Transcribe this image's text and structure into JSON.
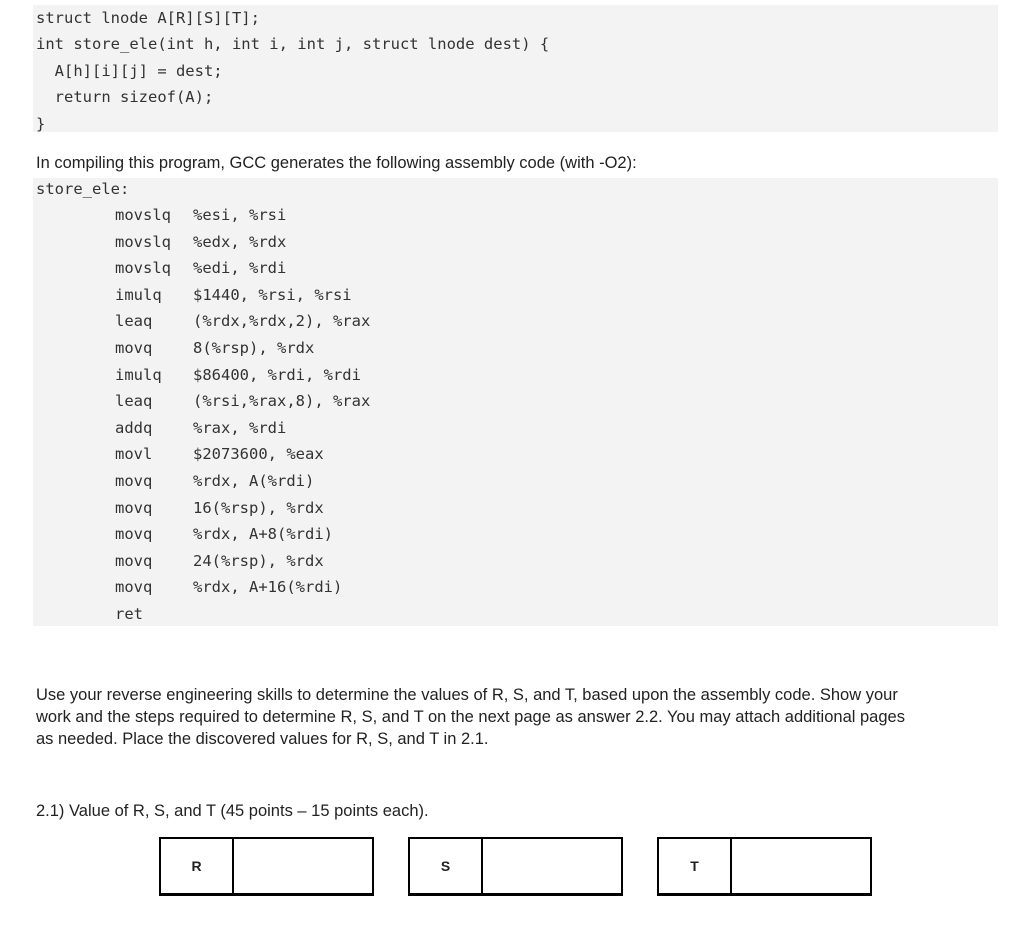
{
  "c_code": [
    "struct lnode A[R][S][T];",
    "int store_ele(int h, int i, int j, struct lnode dest) {",
    "  A[h][i][j] = dest;",
    "  return sizeof(A);",
    "}"
  ],
  "intro": "In compiling this program, GCC generates the following assembly code (with -O2):",
  "asm_label": "store_ele:",
  "asm": [
    {
      "op": "movslq",
      "args": "%esi, %rsi"
    },
    {
      "op": "movslq",
      "args": "%edx, %rdx"
    },
    {
      "op": "movslq",
      "args": "%edi, %rdi"
    },
    {
      "op": "imulq",
      "args": "$1440, %rsi, %rsi"
    },
    {
      "op": "leaq",
      "args": "(%rdx,%rdx,2), %rax"
    },
    {
      "op": "movq",
      "args": "8(%rsp), %rdx"
    },
    {
      "op": "imulq",
      "args": "$86400, %rdi, %rdi"
    },
    {
      "op": "leaq",
      "args": "(%rsi,%rax,8), %rax"
    },
    {
      "op": "addq",
      "args": "%rax, %rdi"
    },
    {
      "op": "movl",
      "args": "$2073600, %eax"
    },
    {
      "op": "movq",
      "args": "%rdx, A(%rdi)"
    },
    {
      "op": "movq",
      "args": "16(%rsp), %rdx"
    },
    {
      "op": "movq",
      "args": "%rdx, A+8(%rdi)"
    },
    {
      "op": "movq",
      "args": "24(%rsp), %rdx"
    },
    {
      "op": "movq",
      "args": "%rdx, A+16(%rdi)"
    },
    {
      "op": "ret",
      "args": ""
    }
  ],
  "instructions": [
    "Use your reverse engineering skills to determine the values of R, S, and T, based upon the assembly code.  Show your",
    "work and the steps required to determine R, S, and T on the next page as answer 2.2.  You may attach additional pages",
    "as needed.  Place the discovered values for R, S, and T in 2.1."
  ],
  "question": "2.1) Value of R, S, and T (45 points – 15 points each).",
  "answers": [
    {
      "label": "R",
      "value": ""
    },
    {
      "label": "S",
      "value": ""
    },
    {
      "label": "T",
      "value": ""
    }
  ]
}
